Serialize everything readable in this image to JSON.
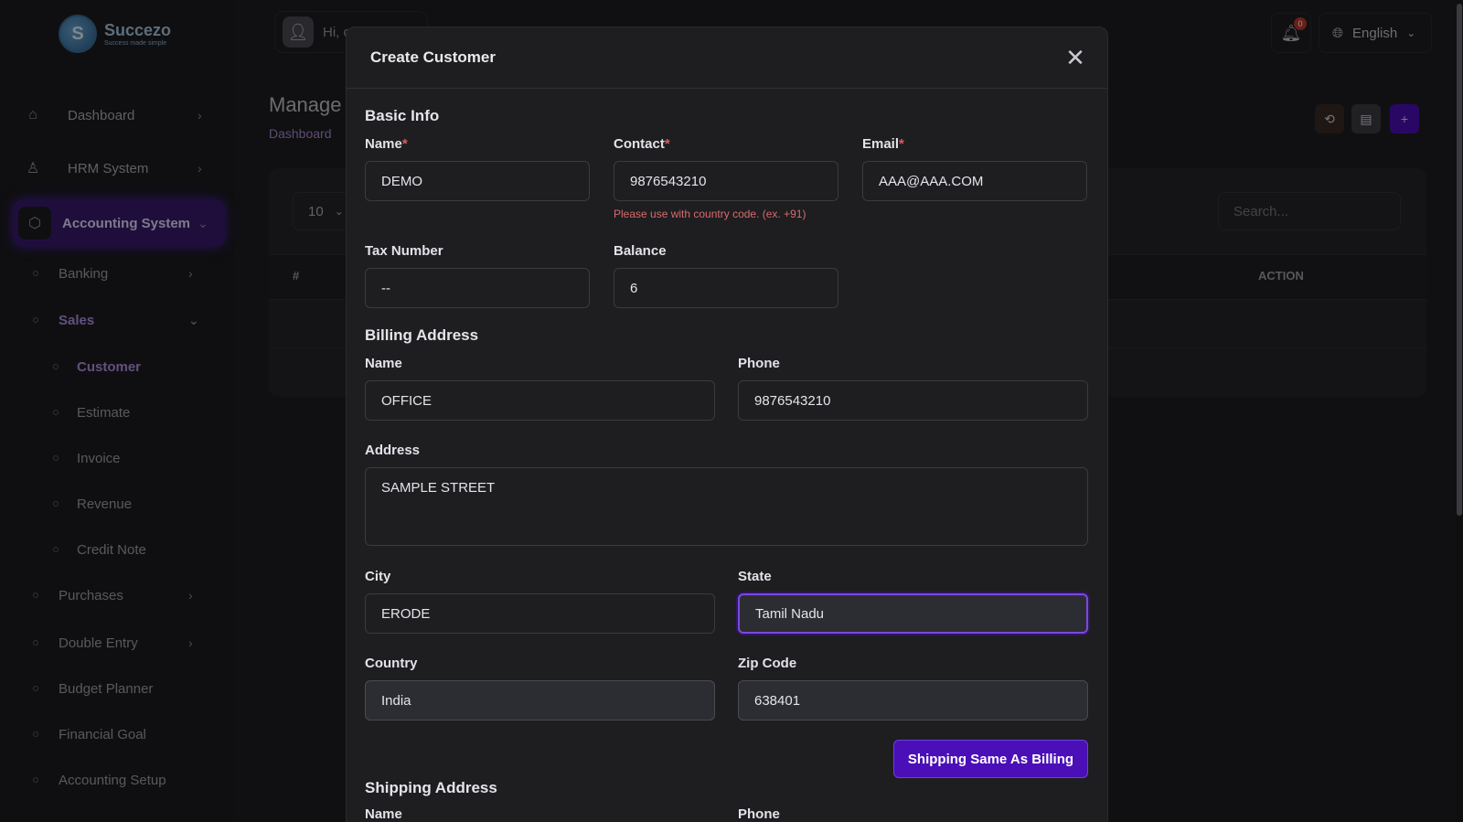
{
  "app": {
    "logo": {
      "name": "Succezo",
      "tagline": "Success made simple",
      "mark": "S"
    },
    "topbar": {
      "greeting": "Hi, c",
      "notification_count": "0",
      "language": "English"
    },
    "sidebar": {
      "items": [
        {
          "label": "Dashboard",
          "icon": "home-icon"
        },
        {
          "label": "HRM System",
          "icon": "user-icon"
        },
        {
          "label": "Accounting System",
          "icon": "box-icon"
        }
      ],
      "accounting_children": [
        {
          "label": "Banking"
        },
        {
          "label": "Sales"
        },
        {
          "label": "Purchases"
        },
        {
          "label": "Double Entry"
        },
        {
          "label": "Budget Planner"
        },
        {
          "label": "Financial Goal"
        },
        {
          "label": "Accounting Setup"
        }
      ],
      "sales_children": [
        {
          "label": "Customer"
        },
        {
          "label": "Estimate"
        },
        {
          "label": "Invoice"
        },
        {
          "label": "Revenue"
        },
        {
          "label": "Credit Note"
        }
      ]
    },
    "page": {
      "title": "Manage",
      "breadcrumb": "Dashboard",
      "entries_value": "10",
      "search_placeholder": "Search...",
      "columns": {
        "hash": "#",
        "action": "ACTION"
      }
    }
  },
  "modal": {
    "title": "Create Customer",
    "basic_info": {
      "title": "Basic Info",
      "name_label": "Name",
      "name_value": "DEMO",
      "contact_label": "Contact",
      "contact_value": "9876543210",
      "contact_hint": "Please use with country code. (ex. +91)",
      "email_label": "Email",
      "email_value": "AAA@AAA.COM",
      "tax_label": "Tax Number",
      "tax_value": "--",
      "balance_label": "Balance",
      "balance_value": "6",
      "required_mark": "*"
    },
    "billing": {
      "title": "Billing Address",
      "name_label": "Name",
      "name_value": "OFFICE",
      "phone_label": "Phone",
      "phone_value": "9876543210",
      "address_label": "Address",
      "address_value": "SAMPLE STREET",
      "city_label": "City",
      "city_value": "ERODE",
      "state_label": "State",
      "state_value": "Tamil Nadu",
      "country_label": "Country",
      "country_value": "India",
      "zip_label": "Zip Code",
      "zip_value": "638401",
      "copy_button": "Shipping Same As Billing"
    },
    "shipping": {
      "title": "Shipping Address",
      "name_label": "Name",
      "phone_label": "Phone"
    }
  },
  "colors": {
    "accent": "#4b0fb8",
    "active_nav": "#3a1a6e",
    "required": "#e05a5a"
  }
}
